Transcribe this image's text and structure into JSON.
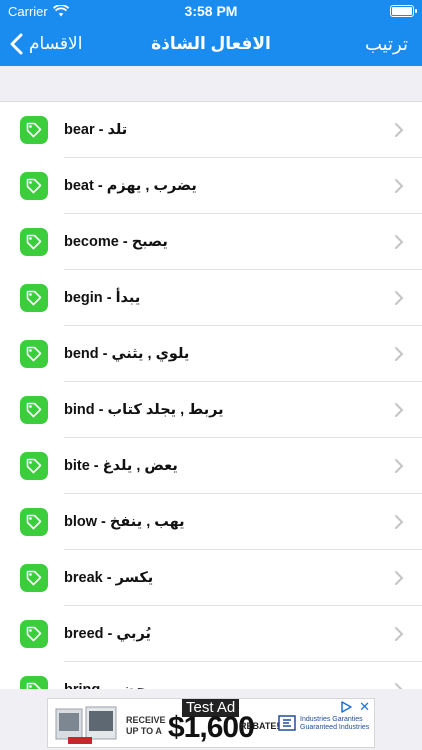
{
  "status": {
    "carrier": "Carrier",
    "time": "3:58 PM"
  },
  "nav": {
    "back_label": "الاقسام",
    "title": "الافعال الشاذة",
    "right_label": "ترتيب"
  },
  "list": {
    "items": [
      {
        "label": "bear - تلد"
      },
      {
        "label": "beat - يضرب , يهزم"
      },
      {
        "label": "become - يصبح"
      },
      {
        "label": "begin - يبدأ"
      },
      {
        "label": "bend - يلوي , يثني"
      },
      {
        "label": "bind - يربط , يجلد كتاب"
      },
      {
        "label": "bite - يعض , يلدغ"
      },
      {
        "label": "blow - يهب , ينفخ"
      },
      {
        "label": "break - يكسر"
      },
      {
        "label": "breed - يُربي"
      },
      {
        "label": "bring - يحضر"
      }
    ]
  },
  "ad": {
    "label": "Test Ad",
    "line1": "RECEIVE",
    "line2": "UP TO A",
    "price": "$1,600",
    "rebate": "REBATE!",
    "brand_line1": "Industries Garanties",
    "brand_line2": "Guaranteed Industries",
    "close": "✕"
  },
  "colors": {
    "nav_blue": "#1a8cf0",
    "tag_green": "#3ccd3c"
  },
  "icons": {
    "row_icon": "tag-icon",
    "row_chevron": "chevron-right-icon"
  }
}
